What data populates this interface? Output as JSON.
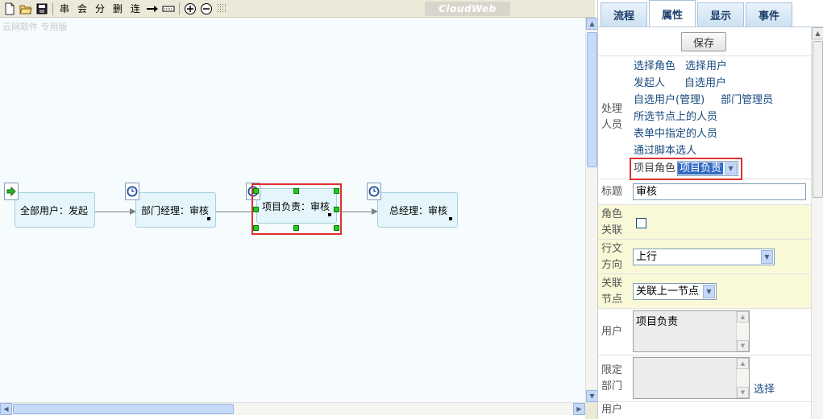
{
  "toolbar": {
    "icons": [
      "new-file-icon",
      "open-folder-icon",
      "save-disk-icon"
    ],
    "text_buttons": [
      "串",
      "会",
      "分",
      "删",
      "连"
    ],
    "brand": "CloudWeb"
  },
  "canvas": {
    "watermark": "云网软件 专用版",
    "nodes": [
      {
        "label": "全部用户：发起",
        "icon": "start-icon"
      },
      {
        "label": "部门经理：审核",
        "icon": "clock-icon"
      },
      {
        "label": "项目负责：审核",
        "icon": "clock-icon"
      },
      {
        "label": "总经理：审核",
        "icon": "clock-icon"
      }
    ]
  },
  "tabs": [
    "流程",
    "属性",
    "显示",
    "事件"
  ],
  "active_tab": "属性",
  "props": {
    "save_label": "保存",
    "handler": {
      "label": "处理人员",
      "links": [
        [
          "选择角色",
          "选择用户"
        ],
        [
          "发起人",
          "自选用户"
        ],
        [
          "自选用户(管理)",
          "部门管理员"
        ],
        [
          "所选节点上的人员"
        ],
        [
          "表单中指定的人员"
        ],
        [
          "通过脚本选人"
        ]
      ],
      "project_role_label": "项目角色",
      "project_role_value": "项目负责"
    },
    "title": {
      "label": "标题",
      "value": "审核"
    },
    "role_link": {
      "label": "角色关联"
    },
    "direction": {
      "label": "行文方向",
      "value": "上行"
    },
    "linked_node": {
      "label": "关联节点",
      "value": "关联上一节点"
    },
    "user": {
      "label": "用户",
      "value": "项目负责"
    },
    "dept": {
      "label": "限定部门",
      "value": "",
      "choose": "选择"
    },
    "user2": {
      "label": "用户"
    }
  },
  "colors": {
    "highlight": "#e03030",
    "node_fill": "#e4f6fb",
    "handle": "#22cc22",
    "link": "#184b7e"
  }
}
